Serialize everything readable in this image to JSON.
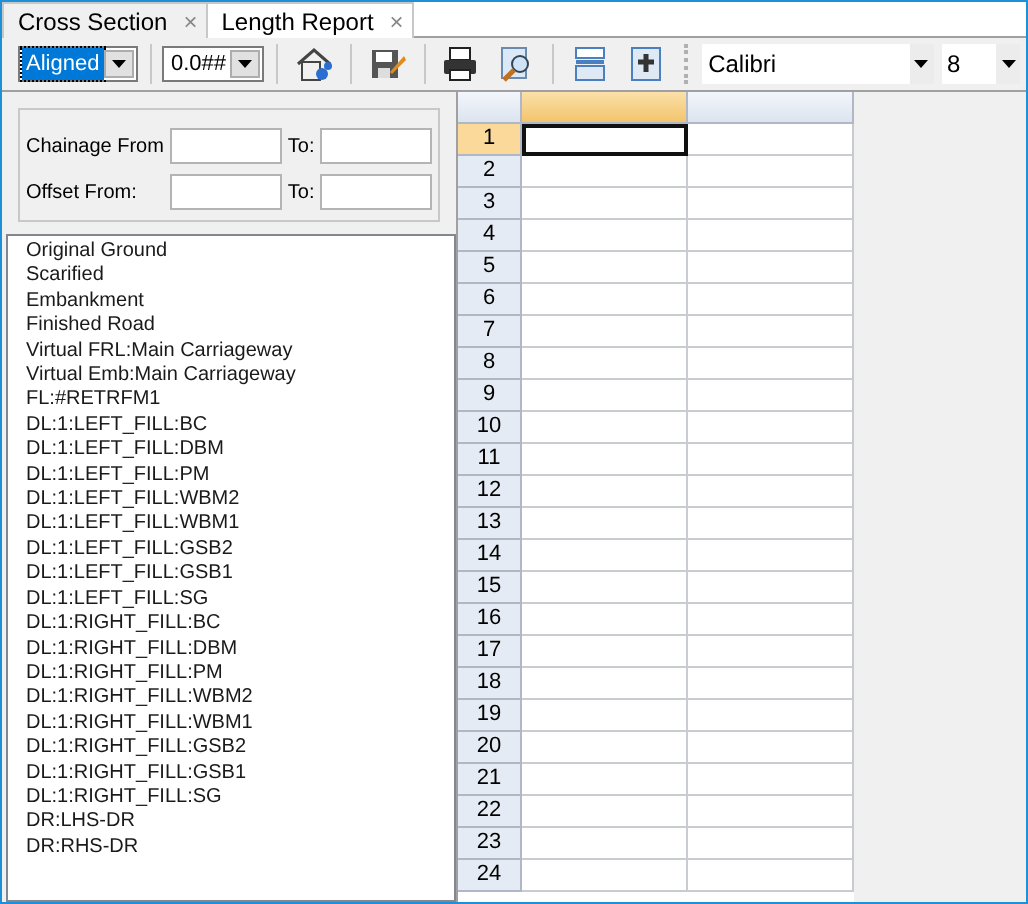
{
  "tabs": [
    {
      "label": "Cross Section",
      "close": "×",
      "selected": false
    },
    {
      "label": "Length Report",
      "close": "×",
      "selected": true
    }
  ],
  "toolbar": {
    "alignment_combo": {
      "value": "Aligned",
      "focused": true
    },
    "format_combo": {
      "value": "0.0##"
    },
    "font_combo": {
      "value": "Calibri"
    },
    "size_combo": {
      "value": "8"
    }
  },
  "filter": {
    "chainage_from_label": "Chainage From",
    "chainage_to_label": "To:",
    "offset_from_label": "Offset From:",
    "offset_to_label": "To:"
  },
  "layers": [
    "Original Ground",
    "Scarified",
    "Embankment",
    "Finished Road",
    "Virtual FRL:Main Carriageway",
    "Virtual Emb:Main Carriageway",
    "FL:#RETRFM1",
    "DL:1:LEFT_FILL:BC",
    "DL:1:LEFT_FILL:DBM",
    "DL:1:LEFT_FILL:PM",
    "DL:1:LEFT_FILL:WBM2",
    "DL:1:LEFT_FILL:WBM1",
    "DL:1:LEFT_FILL:GSB2",
    "DL:1:LEFT_FILL:GSB1",
    "DL:1:LEFT_FILL:SG",
    "DL:1:RIGHT_FILL:BC",
    "DL:1:RIGHT_FILL:DBM",
    "DL:1:RIGHT_FILL:PM",
    "DL:1:RIGHT_FILL:WBM2",
    "DL:1:RIGHT_FILL:WBM1",
    "DL:1:RIGHT_FILL:GSB2",
    "DL:1:RIGHT_FILL:GSB1",
    "DL:1:RIGHT_FILL:SG",
    "DR:LHS-DR",
    "DR:RHS-DR"
  ],
  "grid": {
    "columns": [
      {
        "selected": true
      },
      {
        "selected": false
      }
    ],
    "rows": [
      {
        "label": "1",
        "selected": true
      },
      {
        "label": "2",
        "selected": false
      },
      {
        "label": "3",
        "selected": false
      },
      {
        "label": "4",
        "selected": false
      },
      {
        "label": "5",
        "selected": false
      },
      {
        "label": "6",
        "selected": false
      },
      {
        "label": "7",
        "selected": false
      },
      {
        "label": "8",
        "selected": false
      },
      {
        "label": "9",
        "selected": false
      },
      {
        "label": "10",
        "selected": false
      },
      {
        "label": "11",
        "selected": false
      },
      {
        "label": "12",
        "selected": false
      },
      {
        "label": "13",
        "selected": false
      },
      {
        "label": "14",
        "selected": false
      },
      {
        "label": "15",
        "selected": false
      },
      {
        "label": "16",
        "selected": false
      },
      {
        "label": "17",
        "selected": false
      },
      {
        "label": "18",
        "selected": false
      },
      {
        "label": "19",
        "selected": false
      },
      {
        "label": "20",
        "selected": false
      },
      {
        "label": "21",
        "selected": false
      },
      {
        "label": "22",
        "selected": false
      },
      {
        "label": "23",
        "selected": false
      },
      {
        "label": "24",
        "selected": false
      }
    ]
  }
}
